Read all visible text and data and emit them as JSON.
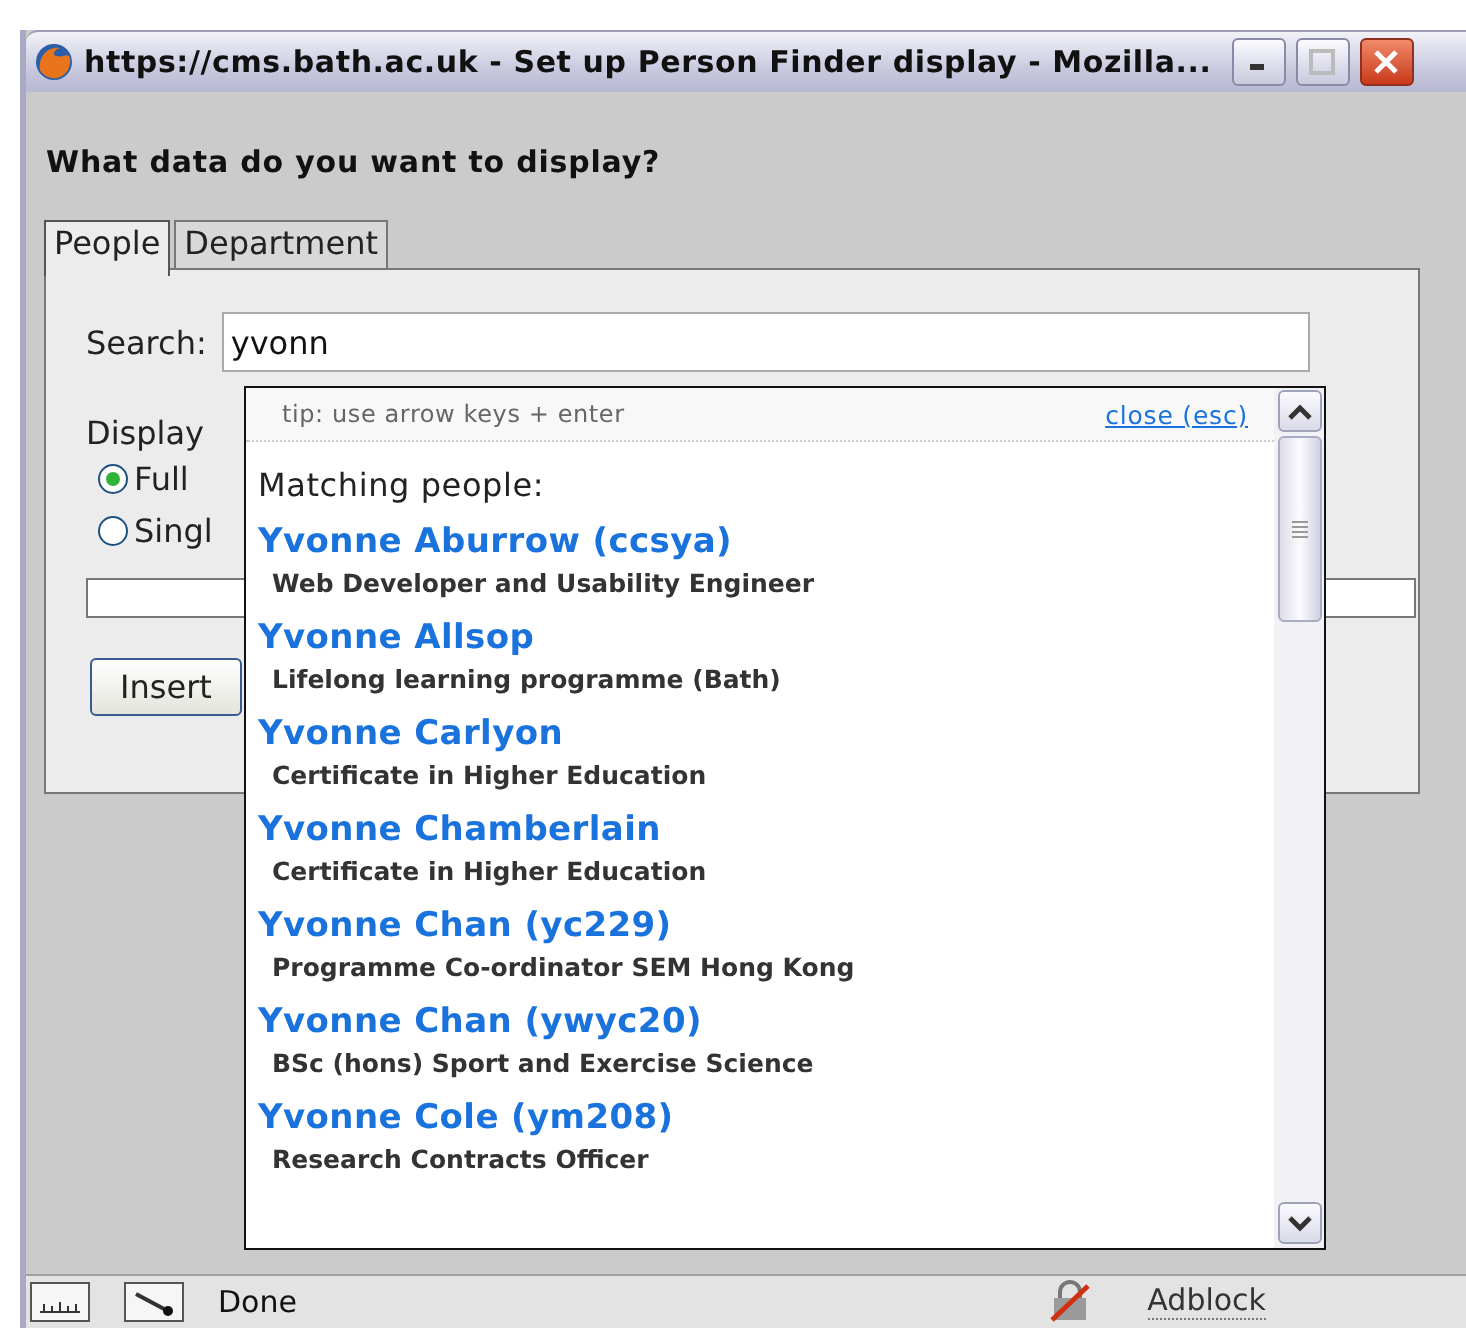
{
  "window": {
    "title": "https://cms.bath.ac.uk - Set up Person Finder display - Mozilla..."
  },
  "heading": "What data do you want to display?",
  "tabs": [
    {
      "label": "People",
      "selected": true
    },
    {
      "label": "Department",
      "selected": false
    }
  ],
  "search": {
    "label": "Search:",
    "value": "yvonn"
  },
  "display": {
    "label": "Display",
    "options": [
      {
        "label": "Full",
        "selected": true
      },
      {
        "label": "Singl",
        "selected": false
      }
    ]
  },
  "insert_button": "Insert",
  "suggestions": {
    "tip": "tip: use arrow keys + enter",
    "close": "close (esc)",
    "heading": "Matching people:",
    "people": [
      {
        "name": "Yvonne Aburrow (ccsya)",
        "role": "Web Developer and Usability Engineer"
      },
      {
        "name": "Yvonne Allsop",
        "role": "Lifelong learning programme (Bath)"
      },
      {
        "name": "Yvonne Carlyon",
        "role": "Certificate in Higher Education"
      },
      {
        "name": "Yvonne Chamberlain",
        "role": "Certificate in Higher Education"
      },
      {
        "name": "Yvonne Chan (yc229)",
        "role": "Programme Co-ordinator SEM Hong Kong"
      },
      {
        "name": "Yvonne Chan (ywyc20)",
        "role": "BSc (hons) Sport and Exercise Science"
      },
      {
        "name": "Yvonne Cole (ym208)",
        "role": "Research Contracts Officer"
      }
    ]
  },
  "status_bar": {
    "text": "Done",
    "adblock": "Adblock"
  }
}
